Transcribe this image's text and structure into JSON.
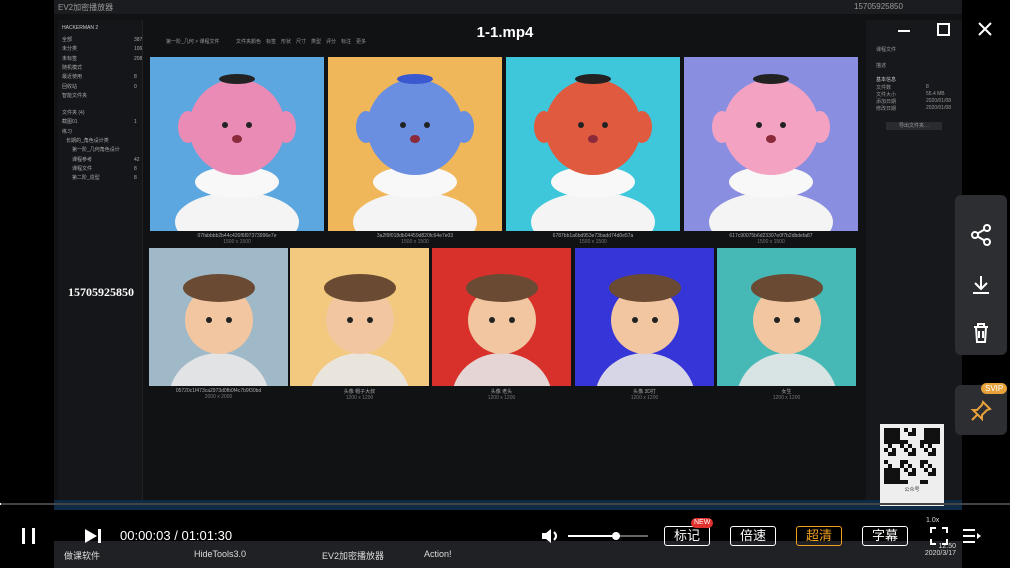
{
  "player": {
    "video_title": "1-1.mp4",
    "watermark_text": "15705925850",
    "time_current": "00:00:03",
    "time_total": "01:01:30",
    "progress_fraction": 0.001,
    "volume_fraction": 0.6,
    "buttons": {
      "mark": "标记",
      "mark_badge": "NEW",
      "speed": "倍速",
      "quality": "超清",
      "subtitle": "字幕"
    },
    "svip_badge": "SVIP",
    "qr_caption": "公众号"
  },
  "recorded_app": {
    "window_title": "EV2加密播放器",
    "window_title_right": "15705925850",
    "left_panel": {
      "brand": "HACKERMAN 2",
      "items": [
        {
          "label": "全部",
          "count": "387"
        },
        {
          "label": "未分类",
          "count": "106"
        },
        {
          "label": "未标签",
          "count": "208"
        },
        {
          "label": "随机模式",
          "count": ""
        },
        {
          "label": "最近使用",
          "count": "8"
        },
        {
          "label": "回收站",
          "count": "0"
        },
        {
          "label": "智能文件夹",
          "count": ""
        },
        {
          "label": "文件夹 (4)",
          "count": ""
        },
        {
          "label": "截图01",
          "count": "1"
        },
        {
          "label": "练习",
          "count": ""
        },
        {
          "label": "长期的_角色设计类",
          "count": ""
        },
        {
          "label": "第一阶_几何角色设计",
          "count": ""
        },
        {
          "label": "课程参考",
          "count": "42"
        },
        {
          "label": "课程文件",
          "count": "8"
        },
        {
          "label": "第二阶_造型",
          "count": "8"
        }
      ]
    },
    "breadcrumb": "第一阶_几何 > 课程文件",
    "filters": [
      "文件夹",
      "颜色",
      "标签",
      "形状",
      "尺寸",
      "类型",
      "评分",
      "标注",
      "更多"
    ],
    "right_panel": {
      "folder_label": "课程文件",
      "note_label": "描述",
      "info_title": "基本信息",
      "rows": [
        {
          "k": "文件数",
          "v": "8"
        },
        {
          "k": "文件大小",
          "v": "55.4 MB"
        },
        {
          "k": "添加日期",
          "v": "2020/01/08"
        },
        {
          "k": "修改日期",
          "v": "2020/01/08"
        }
      ],
      "button": "导出文件夹…"
    },
    "thumbnails_row1": [
      {
        "name": "07fabbbb2b44c426f6f97373996e7e",
        "size": "1500 x 1500",
        "bg": "#5da7e0",
        "face": "#e98bb5",
        "hat": "#222222"
      },
      {
        "name": "3a2f9f018db04459d820fc64e7e03",
        "size": "1500 x 1500",
        "bg": "#f0b65a",
        "face": "#6a8fe0",
        "hat": "#3a59d0"
      },
      {
        "name": "6787bb1a6bd953e73badd74d0e57a",
        "size": "1500 x 1500",
        "bg": "#3ec7da",
        "face": "#e05a40",
        "hat": "#222222"
      },
      {
        "name": "617c90075b6d23307e0f7b2dbdefa87",
        "size": "1500 x 1500",
        "bg": "#8a8ee0",
        "face": "#f4a2c2",
        "hat": "#222222"
      }
    ],
    "thumbnails_row2": [
      {
        "name": "05720c1f473ca2973d0fb0f4c7b9f30bd",
        "size": "2000 x 2000",
        "bg": "#9fb9c9"
      },
      {
        "name": "头像 帽子大叔",
        "size": "1200 x 1200",
        "bg": "#f2c97e"
      },
      {
        "name": "头像 老头",
        "size": "1200 x 1200",
        "bg": "#d8302a"
      },
      {
        "name": "头像 3D打",
        "size": "1200 x 1200",
        "bg": "#3535d8"
      },
      {
        "name": "女生",
        "size": "1200 x 1200",
        "bg": "#46b9b6"
      }
    ],
    "taskbar_items": [
      {
        "label": "做课软件"
      },
      {
        "label": "HideTools3.0"
      },
      {
        "label": "EV2加密播放器"
      },
      {
        "label": "Action!"
      }
    ],
    "clock_time": "12:50",
    "clock_date": "2020/3/17",
    "speed_readout": "1.0x"
  },
  "colors": {
    "accent_orange": "#f0a020",
    "new_badge": "#e0312f",
    "svip_badge": "#e7a23b"
  }
}
